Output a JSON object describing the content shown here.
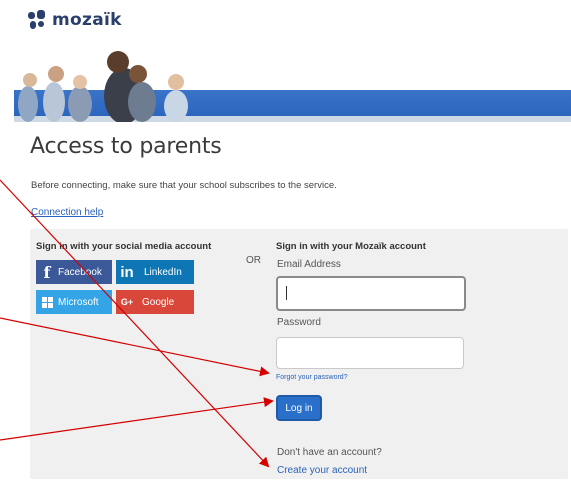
{
  "brand": {
    "name": "mozaïk"
  },
  "page": {
    "title": "Access to parents",
    "intro": "Before connecting, make sure that your school subscribes to the service.",
    "help_link": "Connection help"
  },
  "social": {
    "heading": "Sign in with your social media account",
    "buttons": [
      {
        "label": "Facebook",
        "icon": "f",
        "color": "#3b5998"
      },
      {
        "label": "LinkedIn",
        "icon": "in",
        "color": "#0e76b4"
      },
      {
        "label": "Microsoft",
        "icon": "windows-logo",
        "color": "#34a4e6"
      },
      {
        "label": "Google",
        "icon": "G+",
        "color": "#d9473a"
      }
    ]
  },
  "separator": "OR",
  "mozaik_login": {
    "heading": "Sign in with your Mozaïk account",
    "email_label": "Email Address",
    "email_value": "",
    "password_label": "Password",
    "password_value": "",
    "forgot_link": "Forgot your password?",
    "login_button": "Log in",
    "no_account_text": "Don't have an account?",
    "create_link": "Create your account"
  },
  "annotations": {
    "arrow_color": "#d40000"
  },
  "theme": {
    "accent": "#2a63bb",
    "banner": "#3a74c9",
    "panel": "#f0f0f0"
  }
}
